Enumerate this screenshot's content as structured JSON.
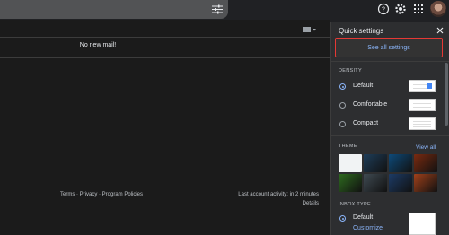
{
  "main": {
    "empty_message": "No new mail!",
    "footer_links": "Terms · Privacy · Program Policies",
    "last_activity": "Last account activity: in 2 minutes",
    "details": "Details"
  },
  "quick_settings": {
    "title": "Quick settings",
    "see_all": "See all settings",
    "density": {
      "label": "DENSITY",
      "options": [
        "Default",
        "Comfortable",
        "Compact"
      ],
      "selected": "Default"
    },
    "theme": {
      "label": "THEME",
      "view_all": "View all",
      "tiles": [
        "#f1f3f4",
        "#1e3d59",
        "#0d4a7a",
        "#7a2a10",
        "#2e6b1f",
        "#3f4a52",
        "#1c3b66",
        "#a0401a"
      ]
    },
    "inbox_type": {
      "label": "INBOX TYPE",
      "selected": "Default",
      "customize": "Customize"
    }
  },
  "colors": {
    "accent": "#8ab4f8",
    "highlight_border": "#e53935"
  }
}
